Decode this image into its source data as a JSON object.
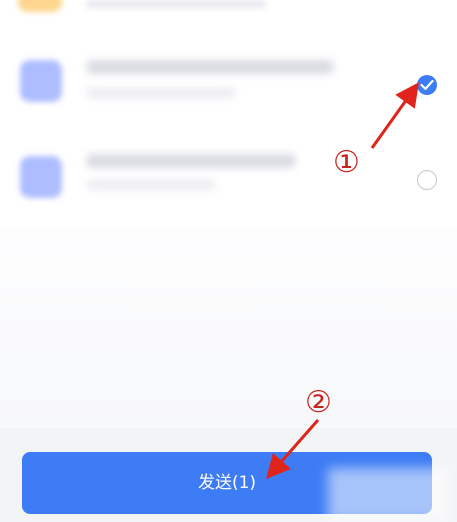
{
  "send_button": {
    "label": "发送(1)"
  },
  "contacts": {
    "selected_count": 1,
    "items": [
      {
        "checked": true
      },
      {
        "checked": false
      }
    ]
  },
  "annotations": {
    "step_1": "①",
    "step_2": "②",
    "arrow_color": "#e0241b"
  },
  "colors": {
    "accent": "#3d7cf5",
    "avatar": "#aebdff",
    "bottom_bar": "#f3f4f6"
  },
  "icons": {
    "checked": "check-icon",
    "arrow": "arrow-icon"
  }
}
